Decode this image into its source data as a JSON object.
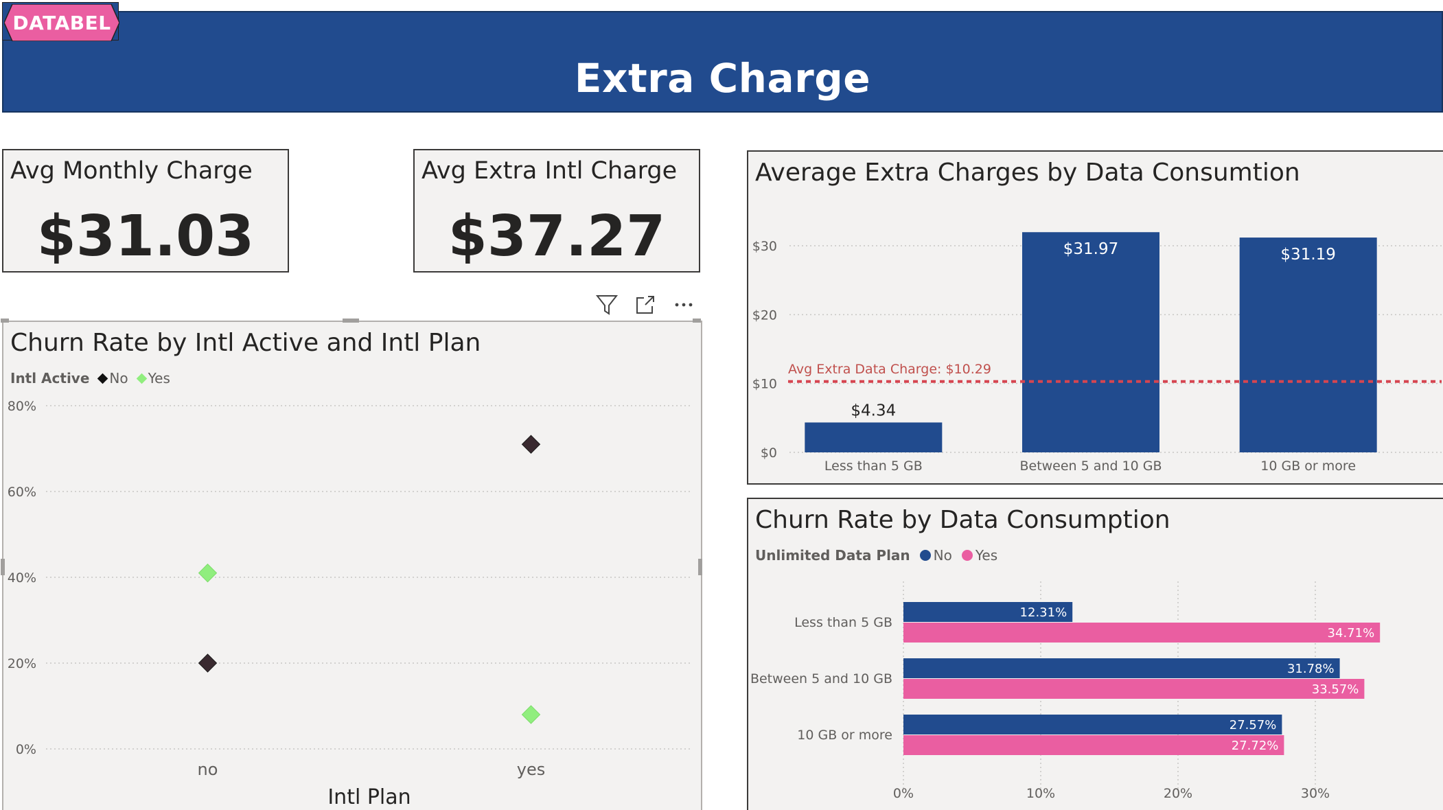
{
  "header": {
    "logo_text": "DATABEL",
    "title": "Extra Charge"
  },
  "kpis": [
    {
      "label": "Avg Monthly Charge",
      "value": "$31.03"
    },
    {
      "label": "Avg Extra Intl Charge",
      "value": "$37.27"
    }
  ],
  "toolbar": {
    "icons": [
      "filter-icon",
      "focus-mode-icon",
      "more-options-icon"
    ]
  },
  "colors": {
    "banner": "#214b8e",
    "logo_pink": "#ea5ea1",
    "navy": "#214b8e",
    "pink": "#ea5ea1",
    "dark_diamond": "#3a2a30",
    "green_diamond": "#90ee7e",
    "ref_line": "#d64550"
  },
  "panels": {
    "scatter": {
      "title": "Churn Rate by Intl Active and Intl Plan",
      "legend_title": "Intl Active",
      "legend_items": [
        "No",
        "Yes"
      ]
    },
    "bar": {
      "title": "Average Extra Charges by Data Consumtion"
    },
    "hbar": {
      "title": "Churn Rate by Data Consumption",
      "legend_title": "Unlimited Data Plan",
      "legend_items": [
        "No",
        "Yes"
      ]
    }
  },
  "chart_data": [
    {
      "type": "scatter",
      "title": "Churn Rate by Intl Active and Intl Plan",
      "xlabel": "Intl Plan",
      "ylabel": "",
      "categories": [
        "no",
        "yes"
      ],
      "ylim": [
        0,
        80
      ],
      "y_ticks": [
        "0%",
        "20%",
        "40%",
        "60%",
        "80%"
      ],
      "legend_title": "Intl Active",
      "series": [
        {
          "name": "No",
          "values": [
            20,
            71
          ],
          "color": "#3a2a30"
        },
        {
          "name": "Yes",
          "values": [
            41,
            8
          ],
          "color": "#90ee7e"
        }
      ],
      "grid": true,
      "legend_position": "top-left"
    },
    {
      "type": "bar",
      "title": "Average Extra Charges by Data Consumtion",
      "categories": [
        "Less than 5 GB",
        "Between 5 and 10 GB",
        "10 GB or more"
      ],
      "values": [
        4.34,
        31.97,
        31.19
      ],
      "data_labels": [
        "$4.34",
        "$31.97",
        "$31.19"
      ],
      "ylim": [
        0,
        30
      ],
      "y_ticks": [
        "$0",
        "$10",
        "$20",
        "$30"
      ],
      "reference_line": {
        "label": "Avg Extra Data Charge: $10.29",
        "value": 10.29
      },
      "color": "#214b8e",
      "grid": true
    },
    {
      "type": "bar",
      "orientation": "horizontal",
      "title": "Churn Rate by Data Consumption",
      "categories": [
        "Less than 5 GB",
        "Between 5 and 10 GB",
        "10 GB or more"
      ],
      "legend_title": "Unlimited Data Plan",
      "series": [
        {
          "name": "No",
          "values": [
            12.31,
            31.78,
            27.57
          ],
          "labels": [
            "12.31%",
            "31.78%",
            "27.57%"
          ],
          "color": "#214b8e"
        },
        {
          "name": "Yes",
          "values": [
            34.71,
            33.57,
            27.72
          ],
          "labels": [
            "34.71%",
            "33.57%",
            "27.72%"
          ],
          "color": "#ea5ea1"
        }
      ],
      "xlim": [
        0,
        30
      ],
      "x_ticks": [
        "0%",
        "10%",
        "20%",
        "30%"
      ],
      "grid": true,
      "legend_position": "top-left"
    }
  ]
}
